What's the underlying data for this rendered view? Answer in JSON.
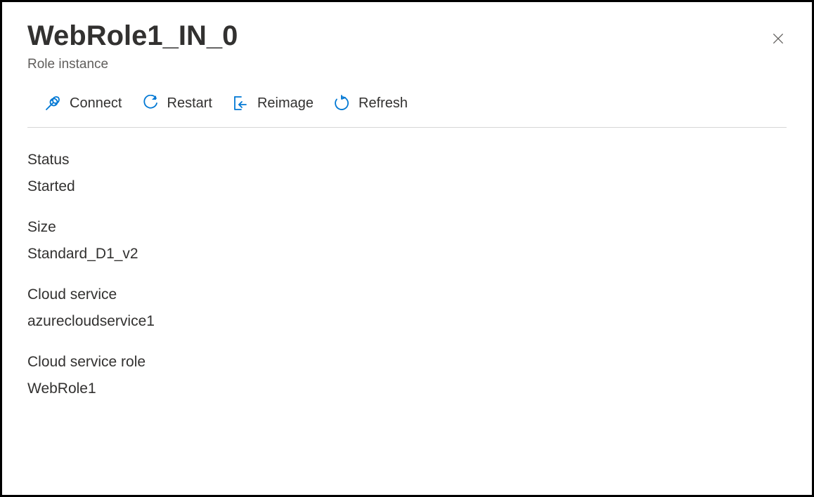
{
  "header": {
    "title": "WebRole1_IN_0",
    "subtitle": "Role instance"
  },
  "toolbar": {
    "connect": "Connect",
    "restart": "Restart",
    "reimage": "Reimage",
    "refresh": "Refresh"
  },
  "fields": {
    "status": {
      "label": "Status",
      "value": "Started"
    },
    "size": {
      "label": "Size",
      "value": "Standard_D1_v2"
    },
    "cloud_service": {
      "label": "Cloud service",
      "value": "azurecloudservice1"
    },
    "cloud_service_role": {
      "label": "Cloud service role",
      "value": "WebRole1"
    }
  },
  "colors": {
    "accent": "#0078d4",
    "text": "#323130",
    "muted": "#605e5c",
    "divider": "#d6d6d6"
  }
}
